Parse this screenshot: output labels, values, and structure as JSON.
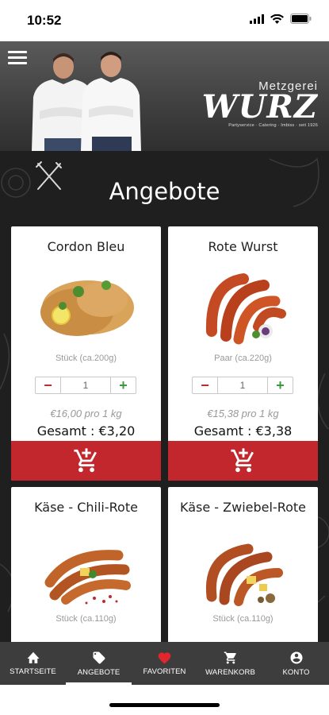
{
  "status": {
    "time": "10:52"
  },
  "header": {
    "logo_top": "Metzgerei",
    "logo_main": "WURZ",
    "logo_sub": "Partyservice · Catering · Imbiss · seit 1926"
  },
  "page_title": "Angebote",
  "products": [
    {
      "title": "Cordon Bleu",
      "size": "Stück (ca.200g)",
      "qty": "1",
      "price_per_kg": "€16,00 pro 1 kg",
      "total": "Gesamt : €3,20"
    },
    {
      "title": "Rote Wurst",
      "size": "Paar (ca.220g)",
      "qty": "1",
      "price_per_kg": "€15,38 pro 1 kg",
      "total": "Gesamt : €3,38"
    },
    {
      "title": "Käse - Chili-Rote",
      "size": "Stück (ca.110g)"
    },
    {
      "title": "Käse - Zwiebel-Rote",
      "size": "Stück (ca.110g)"
    }
  ],
  "tabs": [
    {
      "label": "STARTSEITE",
      "icon": "home-icon"
    },
    {
      "label": "ANGEBOTE",
      "icon": "tag-icon"
    },
    {
      "label": "FAVORITEN",
      "icon": "heart-icon"
    },
    {
      "label": "WARENKORB",
      "icon": "cart-icon"
    },
    {
      "label": "KONTO",
      "icon": "account-icon"
    }
  ],
  "colors": {
    "accent_red": "#c1272d",
    "plus_green": "#3c9a3c",
    "tabbar": "#3d3d3d"
  }
}
